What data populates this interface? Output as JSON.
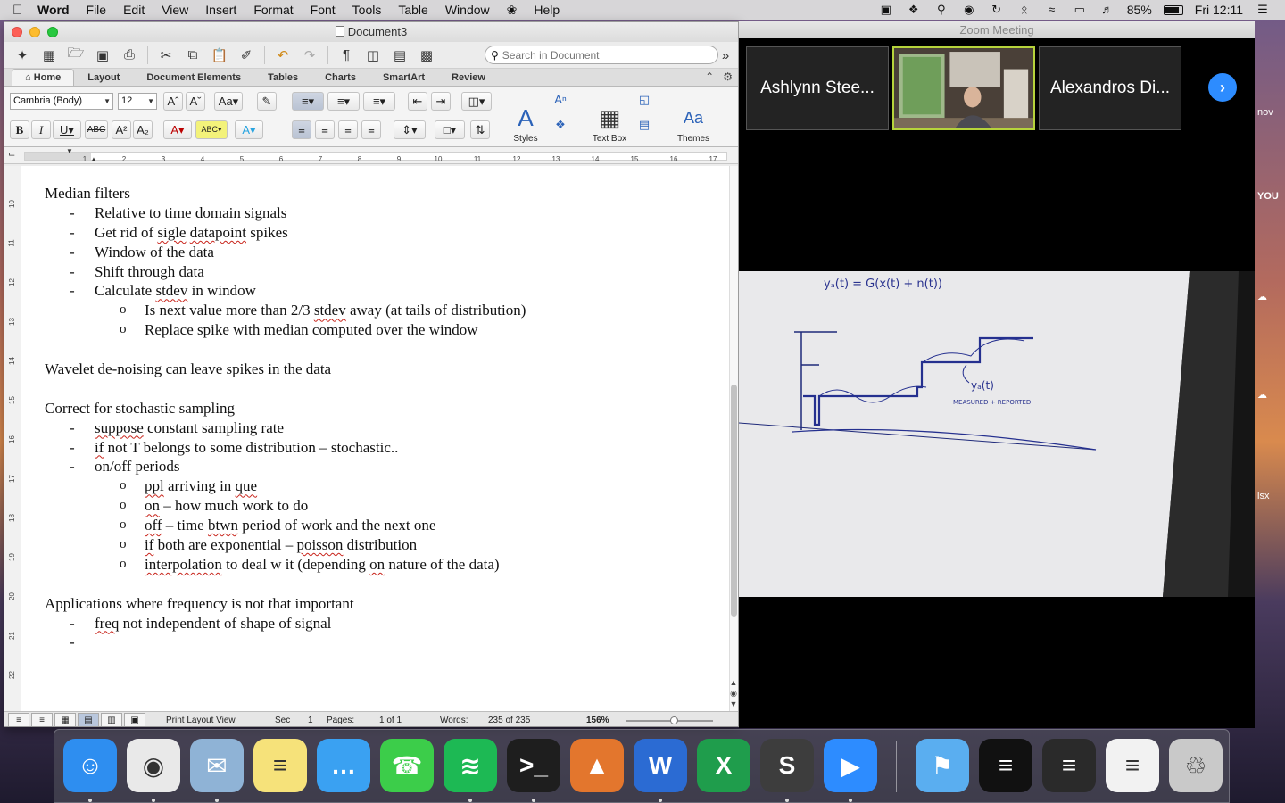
{
  "menubar": {
    "app_name": "Word",
    "items": [
      "File",
      "Edit",
      "View",
      "Insert",
      "Format",
      "Font",
      "Tools",
      "Table",
      "Window",
      "Help"
    ],
    "battery": "85%",
    "clock": "Fri 12:11"
  },
  "word": {
    "doc_title": "Document3",
    "search_placeholder": "Search in Document",
    "ribbon_tabs": [
      "Home",
      "Layout",
      "Document Elements",
      "Tables",
      "Charts",
      "SmartArt",
      "Review"
    ],
    "font_name": "Cambria (Body)",
    "font_size": "12",
    "styles_label": "Styles",
    "textbox_label": "Text Box",
    "themes_label": "Themes",
    "ruler_marks": [
      "1",
      "2",
      "3",
      "4",
      "5",
      "6",
      "7",
      "8",
      "9",
      "10",
      "11",
      "12",
      "13",
      "14",
      "15",
      "16",
      "17"
    ],
    "vruler_marks": [
      "10",
      "11",
      "12",
      "13",
      "14",
      "15",
      "16",
      "17",
      "18",
      "19",
      "20",
      "21",
      "22"
    ],
    "document": {
      "lines": [
        {
          "level": 0,
          "text": "Median filters"
        },
        {
          "level": 1,
          "text": "Relative to time domain signals"
        },
        {
          "level": 1,
          "text": "Get rid of sigle datapoint spikes"
        },
        {
          "level": 1,
          "text": "Window of the data"
        },
        {
          "level": 1,
          "text": "Shift through data"
        },
        {
          "level": 1,
          "text": "Calculate stdev in window"
        },
        {
          "level": 2,
          "text": "Is next value more than 2/3 stdev away (at tails of distribution)"
        },
        {
          "level": 2,
          "text": "Replace spike with median computed over the window"
        },
        {
          "level": -1,
          "text": ""
        },
        {
          "level": 0,
          "text": "Wavelet de-noising can leave spikes in the data"
        },
        {
          "level": -1,
          "text": ""
        },
        {
          "level": 0,
          "text": "Correct for stochastic sampling"
        },
        {
          "level": 1,
          "text": "suppose constant sampling rate"
        },
        {
          "level": 1,
          "text": "if not T belongs to some distribution – stochastic.."
        },
        {
          "level": 1,
          "text": "on/off periods"
        },
        {
          "level": 2,
          "text": "ppl arriving in que"
        },
        {
          "level": 2,
          "text": "on – how much work to do"
        },
        {
          "level": 2,
          "text": "off – time btwn period of work and the next one"
        },
        {
          "level": 2,
          "text": "if both are exponential – poisson distribution"
        },
        {
          "level": 2,
          "text": "interpolation to deal w it (depending on nature of the data)"
        },
        {
          "level": -1,
          "text": ""
        },
        {
          "level": 0,
          "text": "Applications where frequency is not that important"
        },
        {
          "level": 1,
          "text": "freq not independent of shape of signal"
        },
        {
          "level": 1,
          "text": ""
        }
      ]
    },
    "status": {
      "view": "Print Layout View",
      "sec_label": "Sec",
      "sec_value": "1",
      "pages_label": "Pages:",
      "pages_value": "1 of 1",
      "words_label": "Words:",
      "words_value": "235 of 235",
      "zoom": "156%"
    }
  },
  "zoom": {
    "window_title": "Zoom Meeting",
    "participants": [
      "Ashlynn Stee...",
      "Alexandros Di..."
    ],
    "whiteboard": {
      "top_formula": "yₐ(t) = G(x(t) + n(t))",
      "label": "yₐ(t)",
      "note": "MEASURED + REPORTED"
    },
    "side_text": [
      "nov",
      "YOU",
      "lsx"
    ]
  },
  "dock": {
    "apps": [
      {
        "name": "Finder",
        "color": "#2e8ef0",
        "glyph": "☺",
        "running": true
      },
      {
        "name": "Chrome",
        "color": "#e9e9e9",
        "glyph": "◉",
        "running": true
      },
      {
        "name": "Preview",
        "color": "#8fb3d6",
        "glyph": "✉",
        "running": true
      },
      {
        "name": "Notes",
        "color": "#f6e27a",
        "glyph": "≡",
        "running": false
      },
      {
        "name": "Messages",
        "color": "#3aa1f2",
        "glyph": "…",
        "running": false
      },
      {
        "name": "FaceTime",
        "color": "#3ccd4a",
        "glyph": "☎",
        "running": false
      },
      {
        "name": "Spotify",
        "color": "#1db954",
        "glyph": "≋",
        "running": true
      },
      {
        "name": "Terminal",
        "color": "#1e1e1e",
        "glyph": ">_",
        "running": true
      },
      {
        "name": "MATLAB",
        "color": "#e3762d",
        "glyph": "▲",
        "running": false
      },
      {
        "name": "Word",
        "color": "#2b6bd3",
        "glyph": "W",
        "running": true
      },
      {
        "name": "Excel",
        "color": "#1f9d4c",
        "glyph": "X",
        "running": false
      },
      {
        "name": "Sublime Text",
        "color": "#3d3d3d",
        "glyph": "S",
        "running": true
      },
      {
        "name": "Zoom",
        "color": "#2d8cff",
        "glyph": "▶",
        "running": true
      },
      {
        "name": "Downloads",
        "color": "#5aaef0",
        "glyph": "⚑",
        "running": false
      },
      {
        "name": "Terminal window",
        "color": "#111111",
        "glyph": "≡",
        "running": false
      },
      {
        "name": "Sublime window",
        "color": "#2a2a2a",
        "glyph": "≡",
        "running": false
      },
      {
        "name": "Document window",
        "color": "#f2f2f2",
        "glyph": "≡",
        "running": false
      },
      {
        "name": "Trash",
        "color": "#c9c9c9",
        "glyph": "♲",
        "running": false
      }
    ]
  }
}
